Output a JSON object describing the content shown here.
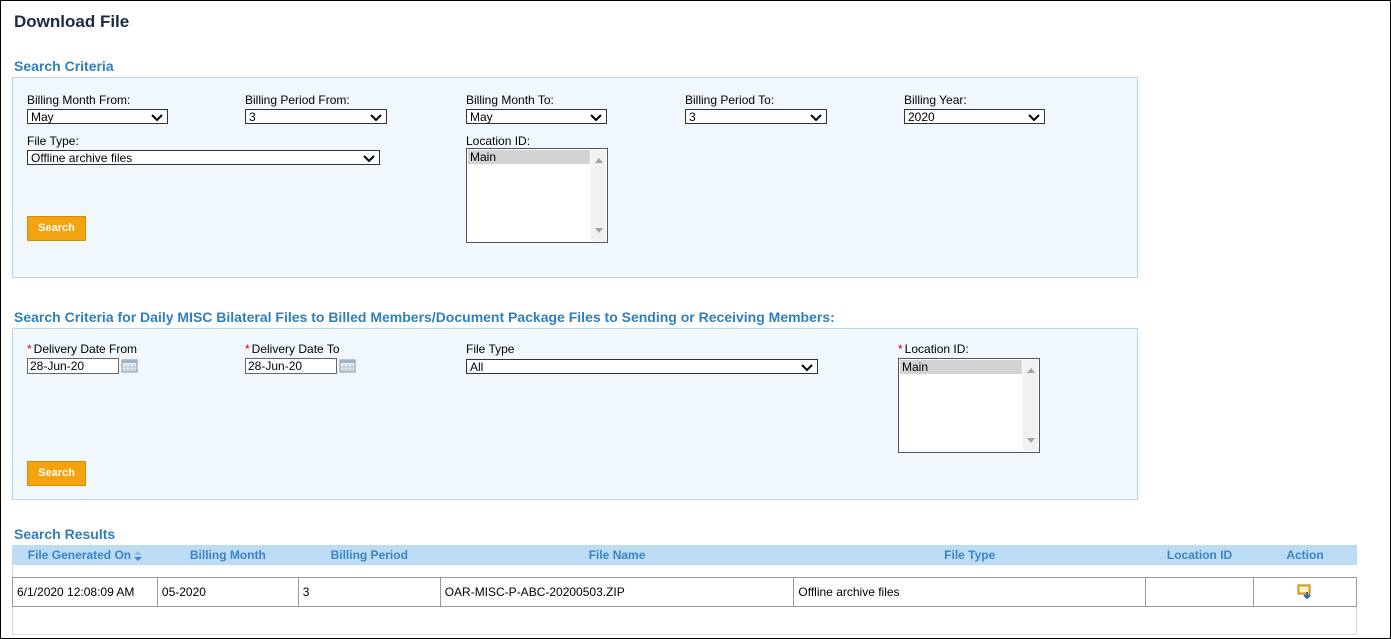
{
  "page": {
    "title": "Download File"
  },
  "criteria": {
    "title": "Search Criteria",
    "billing_month_from": {
      "label": "Billing Month From:",
      "value": "May"
    },
    "billing_period_from": {
      "label": "Billing Period From:",
      "value": "3"
    },
    "billing_month_to": {
      "label": "Billing Month To:",
      "value": "May"
    },
    "billing_period_to": {
      "label": "Billing Period To:",
      "value": "3"
    },
    "billing_year": {
      "label": "Billing Year:",
      "value": "2020"
    },
    "file_type": {
      "label": "File Type:",
      "value": "Offline archive files"
    },
    "location": {
      "label": "Location ID:",
      "options": [
        "Main"
      ]
    },
    "search_label": "Search"
  },
  "daily": {
    "title": "Search Criteria for Daily MISC Bilateral Files to Billed Members/Document Package Files to Sending or Receiving Members:",
    "required_mark": "*",
    "delivery_from": {
      "label": "Delivery Date From",
      "value": "28-Jun-20"
    },
    "delivery_to": {
      "label": "Delivery Date To",
      "value": "28-Jun-20"
    },
    "file_type": {
      "label": "File Type",
      "value": "All"
    },
    "location": {
      "label": "Location ID:",
      "options": [
        "Main"
      ]
    },
    "search_label": "Search"
  },
  "results": {
    "title": "Search Results",
    "columns": [
      "File Generated On",
      "Billing Month",
      "Billing Period",
      "File Name",
      "File Type",
      "Location ID",
      "Action"
    ],
    "rows": [
      [
        "6/1/2020 12:08:09 AM",
        "05-2020",
        "3",
        "OAR-MISC-P-ABC-20200503.ZIP",
        "Offline archive files",
        "",
        "download-icon"
      ]
    ]
  },
  "colors": {
    "accent": "#2f7fbf",
    "button": "#f2a30f",
    "panel": "#f1f8fd",
    "header": "#bcdcf3"
  }
}
